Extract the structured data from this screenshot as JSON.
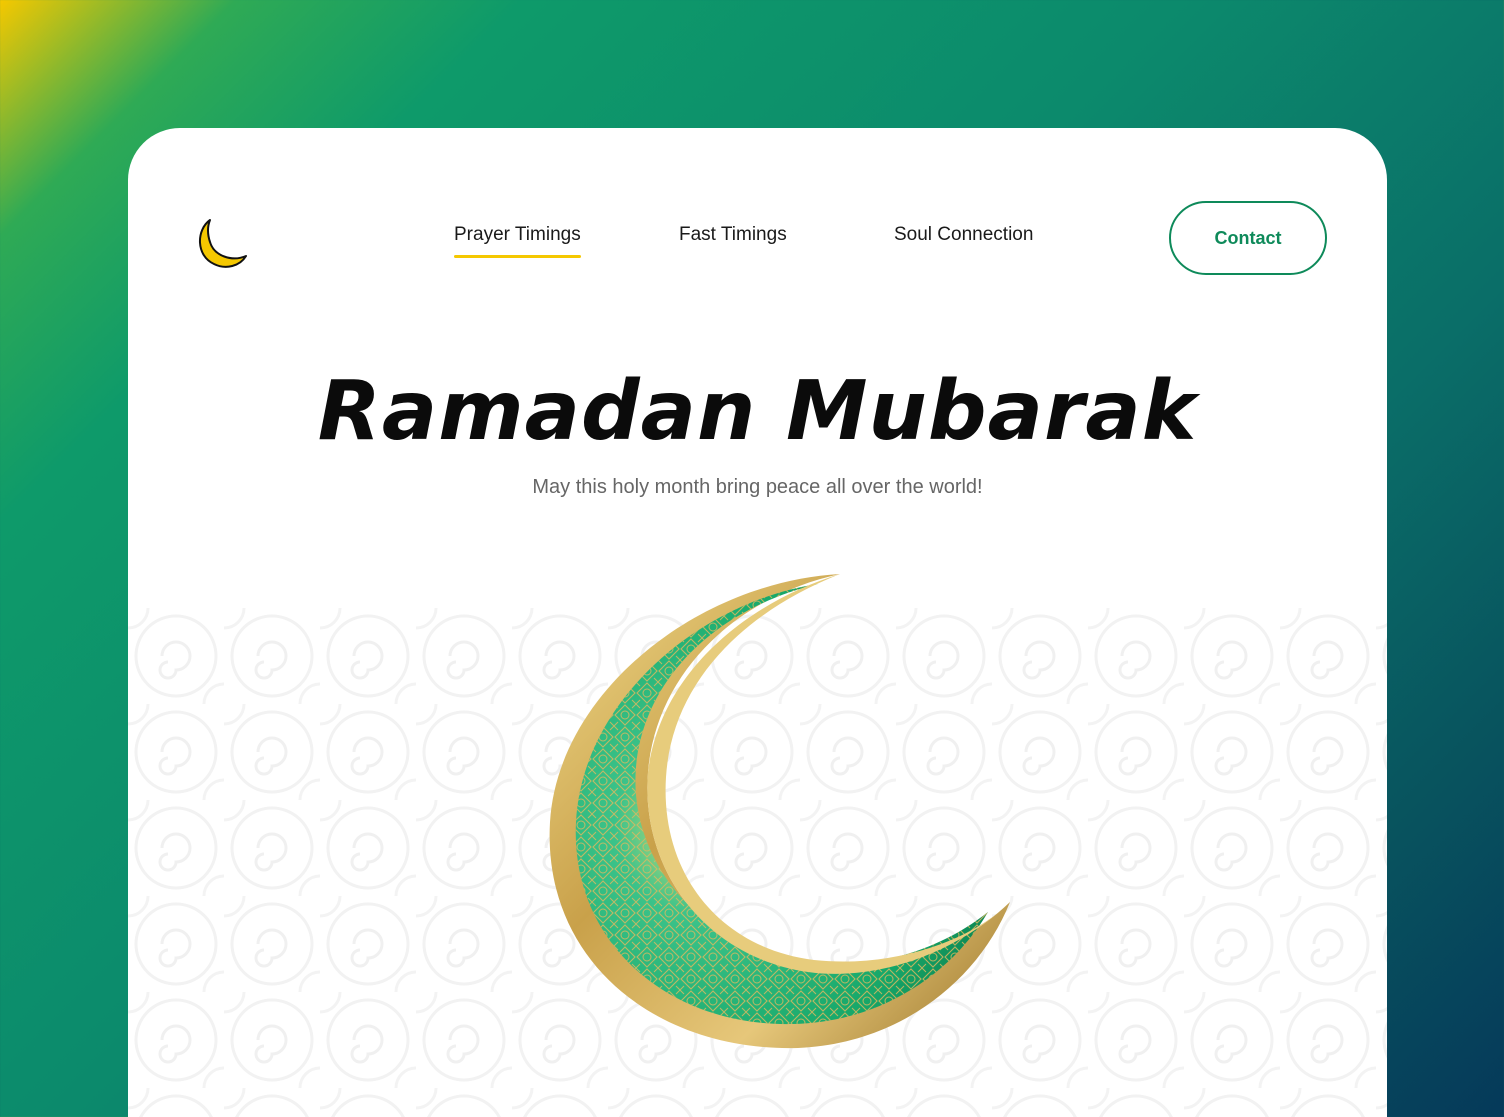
{
  "nav": {
    "items": [
      {
        "label": "Prayer Timings",
        "active": true
      },
      {
        "label": "Fast Timings",
        "active": false
      },
      {
        "label": "Soul Connection",
        "active": false
      }
    ],
    "contact_label": "Contact"
  },
  "hero": {
    "title": "Ramadan Mubarak",
    "subtitle": "May this holy month bring peace all over the world!"
  },
  "icons": {
    "logo": "crescent-moon-icon",
    "hero": "crescent-moon-illustration"
  },
  "colors": {
    "accent_yellow": "#f5c800",
    "brand_green": "#0e8a5a",
    "moon_green": "#17b26e",
    "moon_gold": "#c9a14a"
  }
}
